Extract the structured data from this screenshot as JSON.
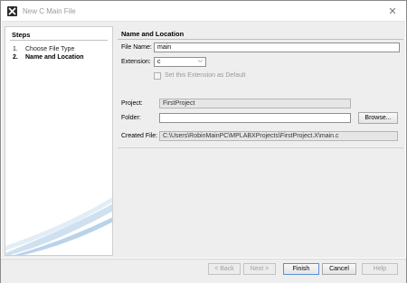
{
  "window": {
    "title": "New C Main File",
    "close_glyph": "✕"
  },
  "steps": {
    "title": "Steps",
    "items": [
      {
        "num": "1.",
        "label": "Choose File Type"
      },
      {
        "num": "2.",
        "label": "Name and Location"
      }
    ]
  },
  "main": {
    "title": "Name and Location",
    "file_name": {
      "label": "File Name:",
      "value": "main"
    },
    "extension": {
      "label": "Extension:",
      "value": "c",
      "chevron": "⌵"
    },
    "set_default": {
      "label": "Set this Extension as Default",
      "checked": false
    },
    "project": {
      "label": "Project:",
      "value": "FirstProject"
    },
    "folder": {
      "label": "Folder:",
      "value": ""
    },
    "browse_label": "Browse...",
    "created_file": {
      "label": "Created File:",
      "value": "C:\\Users\\RobinMainPC\\MPLABXProjects\\FirstProject.X\\main.c"
    }
  },
  "buttons": {
    "back": "< Back",
    "next": "Next >",
    "finish": "Finish",
    "cancel": "Cancel",
    "help": "Help"
  },
  "colors": {
    "swoosh": "#9fc3e3",
    "accent": "#2f6fb6"
  }
}
